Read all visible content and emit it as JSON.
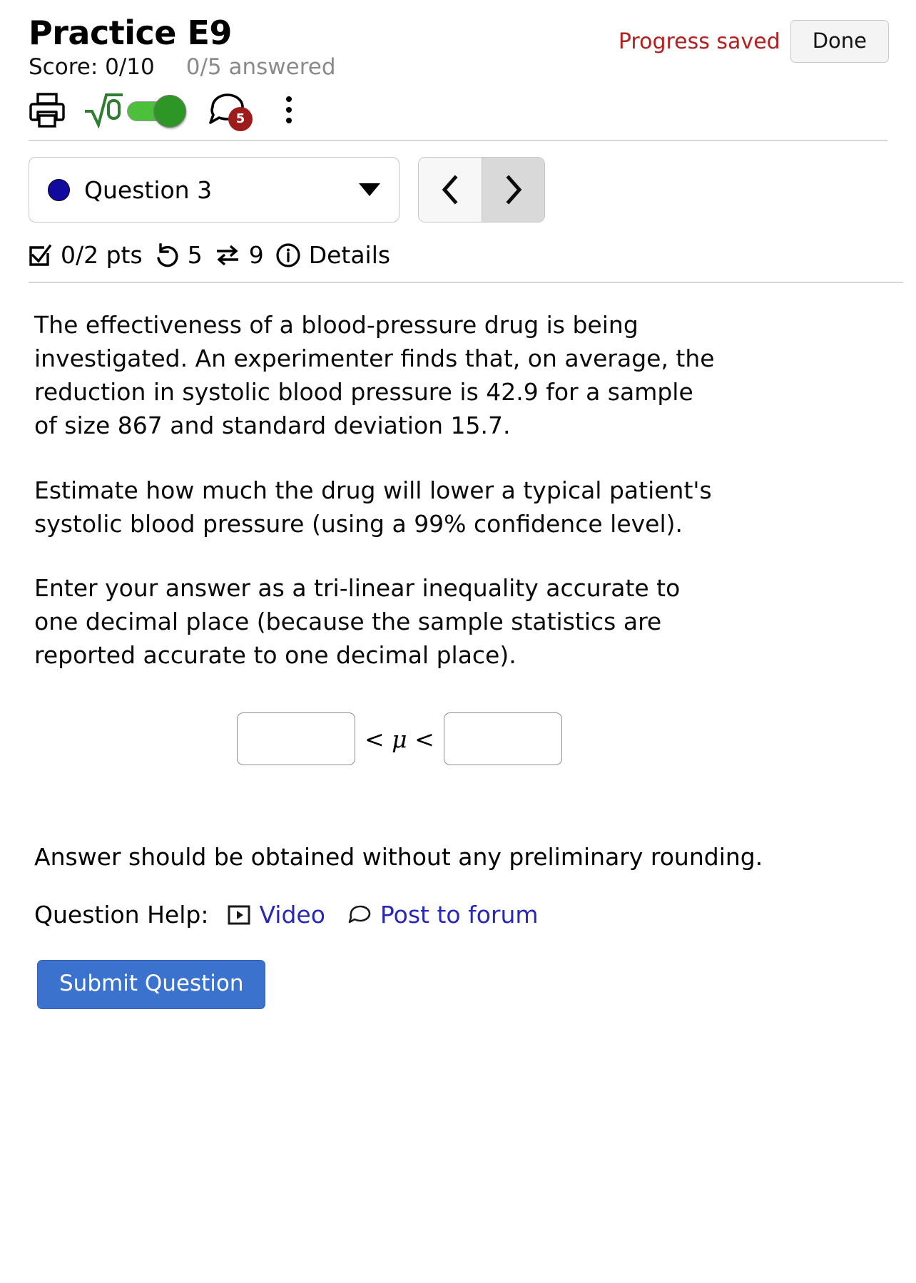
{
  "header": {
    "title": "Practice E9",
    "progress_status": "Progress saved",
    "done_label": "Done",
    "score_label": "Score: 0/10",
    "answered_label": "0/5 answered",
    "progress_color": "#b32020"
  },
  "toolbar": {
    "print_icon": "printer-icon",
    "math_toggle_icon": "square-root-icon",
    "math_toggle_state": "on",
    "chat_icon": "chat-bubble-icon",
    "chat_badge_count": "5",
    "more_icon": "kebab-menu-icon"
  },
  "navigation": {
    "question_marker_color": "#120a9e",
    "question_label": "Question 3",
    "dropdown_icon": "chevron-down-icon",
    "prev_label": "‹",
    "next_label": "›"
  },
  "meta": {
    "points": "0/2 pts",
    "points_icon": "checkbox-check-icon",
    "attempts": "5",
    "attempts_icon": "undo-arrow-icon",
    "versions": "9",
    "versions_icon": "swap-arrows-icon",
    "details_label": "Details",
    "details_icon": "info-circle-icon"
  },
  "question": {
    "paragraph_1": "The effectiveness of a blood-pressure drug is being investigated. An experimenter finds that, on average, the reduction in systolic blood pressure is 42.9 for a sample of size 867 and standard deviation 15.7.",
    "paragraph_2": "Estimate how much the drug will lower a typical patient's systolic blood pressure (using a 99% confidence level).",
    "paragraph_3": "Enter your answer as a tri-linear inequality accurate to one decimal place (because the sample statistics are reported accurate to one decimal place).",
    "note": "Answer should be obtained without any preliminary rounding.",
    "lower_bound_value": "",
    "upper_bound_value": "",
    "inequality_middle": "< μ <"
  },
  "help": {
    "label": "Question Help:",
    "video_label": "Video",
    "video_icon": "video-play-icon",
    "forum_label": "Post to forum",
    "forum_icon": "speech-bubble-icon",
    "link_color": "#2727b8"
  },
  "footer": {
    "submit_label": "Submit Question",
    "submit_color": "#3b72ce"
  }
}
